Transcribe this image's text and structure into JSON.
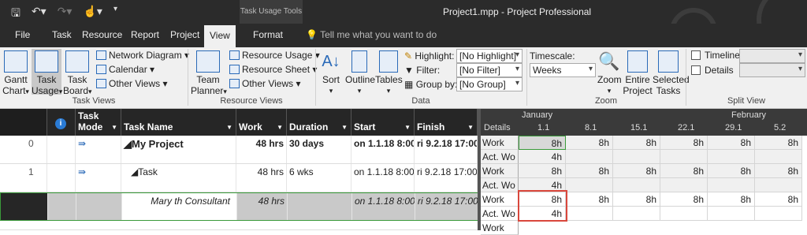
{
  "window": {
    "title": "Project1.mpp  -  Project Professional",
    "context_tab_group": "Task Usage Tools"
  },
  "qat_icons": [
    "save-icon",
    "undo-icon",
    "redo-icon",
    "touch-mode-icon",
    "customize-qat-icon"
  ],
  "tabs": [
    {
      "label": "File"
    },
    {
      "label": "Task"
    },
    {
      "label": "Resource"
    },
    {
      "label": "Report"
    },
    {
      "label": "Project"
    },
    {
      "label": "View"
    },
    {
      "label": "Format"
    }
  ],
  "tell_me": "Tell me what you want to do",
  "ribbon": {
    "task_views": {
      "group": "Task Views",
      "gantt": "Gantt",
      "gantt2": "Chart",
      "usage": "Task",
      "usage2": "Usage",
      "board": "Task",
      "board2": "Board",
      "network": "Network Diagram",
      "calendar": "Calendar",
      "other": "Other Views"
    },
    "resource_views": {
      "group": "Resource Views",
      "planner": "Team",
      "planner2": "Planner",
      "usage": "Resource Usage",
      "sheet": "Resource Sheet",
      "other": "Other Views"
    },
    "data": {
      "group": "Data",
      "sort": "Sort",
      "outline": "Outline",
      "tables": "Tables",
      "highlight_label": "Highlight:",
      "highlight_value": "[No Highlight]",
      "filter_label": "Filter:",
      "filter_value": "[No Filter]",
      "groupby_label": "Group by:",
      "groupby_value": "[No Group]"
    },
    "zoom": {
      "group": "Zoom",
      "timescale_label": "Timescale:",
      "timescale_value": "Weeks",
      "zoom": "Zoom",
      "entire": "Entire",
      "entire2": "Project",
      "selected": "Selected",
      "selected2": "Tasks"
    },
    "split": {
      "group": "Split View",
      "timeline": "Timeline",
      "details": "Details"
    }
  },
  "grid": {
    "headers": {
      "mode1": "Task",
      "mode2": "Mode",
      "name": "Task Name",
      "work": "Work",
      "duration": "Duration",
      "start": "Start",
      "finish": "Finish"
    },
    "rows": [
      {
        "id": "0",
        "name": "My Project",
        "work": "48 hrs",
        "duration": "30 days",
        "start": "on 1.1.18 8:00",
        "finish": "ri 9.2.18 17:00"
      },
      {
        "id": "1",
        "name": "Task",
        "work": "48 hrs",
        "duration": "6 wks",
        "start": "on 1.1.18 8:00",
        "finish": "ri 9.2.18 17:00"
      },
      {
        "id": "",
        "name": "Mary th Consultant",
        "work": "48 hrs",
        "duration": "",
        "start": "on 1.1.18 8:00",
        "finish": "ri 9.2.18 17:00"
      }
    ]
  },
  "usage": {
    "details_header": "Details",
    "month1": "January",
    "month2": "February",
    "weeks": [
      "1.1",
      "8.1",
      "15.1",
      "22.1",
      "29.1",
      "5.2"
    ],
    "detail_labels": {
      "work": "Work",
      "act": "Act. Wo"
    },
    "row0_work": [
      "8h",
      "8h",
      "8h",
      "8h",
      "8h",
      "8h"
    ],
    "row0_act": [
      "4h",
      "",
      "",
      "",
      "",
      ""
    ],
    "row1_work": [
      "8h",
      "8h",
      "8h",
      "8h",
      "8h",
      "8h"
    ],
    "row1_act": [
      "4h",
      "",
      "",
      "",
      "",
      ""
    ],
    "row2_work": [
      "8h",
      "8h",
      "8h",
      "8h",
      "8h",
      "8h"
    ],
    "row2_act": [
      "4h",
      "",
      "",
      "",
      "",
      ""
    ],
    "row3_label": "Work"
  }
}
